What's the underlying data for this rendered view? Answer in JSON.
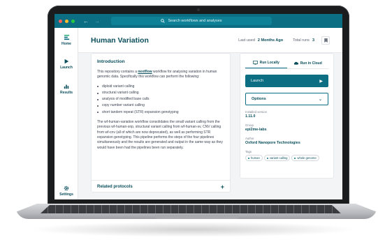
{
  "window": {
    "search_placeholder": "Search workflows and analyses",
    "traffic_lights": [
      "#ff5f57",
      "#febc2e",
      "#28c840"
    ]
  },
  "sidebar": {
    "items": [
      {
        "label": "Home",
        "icon": "home-icon"
      },
      {
        "label": "Launch",
        "icon": "play-icon"
      },
      {
        "label": "Results",
        "icon": "bar-chart-icon"
      },
      {
        "label": "Settings",
        "icon": "gear-icon"
      }
    ]
  },
  "header": {
    "title": "Human Variation",
    "last_used_label": "Last used",
    "last_used_value": "2 Months Ago",
    "total_runs_label": "Total runs",
    "total_runs_value": "3"
  },
  "intro": {
    "title": "Introduction",
    "para1_a": "This repository contains a ",
    "para1_link": "nextflow",
    "para1_b": " workflow for analysing variation in human genomic data. Specifically this workflow can perform the following:",
    "bullets": [
      "diploid variant calling",
      "structural variant calling",
      "analysis of modified base calls",
      "copy number variant calling",
      "short tandem repeat (STR) expansion genotyping"
    ],
    "para2": "The wf-human-variation workflow consolidates the small variant calling from the previous wf-human-snp, structural variant calling from wf-human-sv, CNV calling from wf-cnv (all of which are now deprecated), as well as performing STR expansion genotyping. This pipeline performs the steps of the four pipelines simultaneously and the results are generated and output in the same way as they would have been had the pipelines been run separately.",
    "related_label": "Related protocols"
  },
  "panel": {
    "tab_local": "Run Locally",
    "tab_cloud": "Run in Cloud",
    "launch_label": "Launch",
    "options_label": "Options",
    "version_label": "Installed version",
    "version_value": "1.11.0",
    "group_label": "Group",
    "group_value": "epi2me-labs",
    "author_label": "Author",
    "author_value": "Oxford Nanopore Technologies",
    "tags_label": "Tags",
    "tags": [
      "human",
      "variant calling",
      "whole genome"
    ]
  },
  "colors": {
    "accent": "#0b6e82",
    "text_dark": "#0b4f5c"
  }
}
